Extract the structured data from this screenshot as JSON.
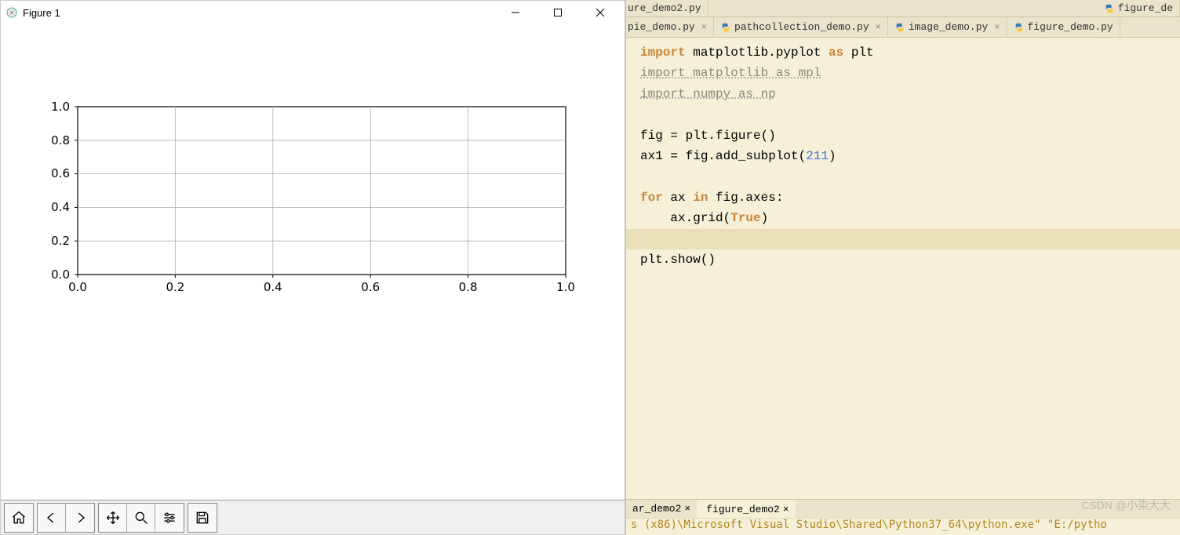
{
  "figure_window": {
    "title": "Figure 1",
    "toolbar": {
      "home": "Home",
      "back": "Back",
      "forward": "Forward",
      "pan": "Pan",
      "zoom": "Zoom",
      "configure": "Configure subplots",
      "save": "Save"
    }
  },
  "chart_data": {
    "type": "line",
    "title": "",
    "xlabel": "",
    "ylabel": "",
    "xlim": [
      0.0,
      1.0
    ],
    "ylim": [
      0.0,
      1.0
    ],
    "xticks": [
      0.0,
      0.2,
      0.4,
      0.6,
      0.8,
      1.0
    ],
    "yticks": [
      0.0,
      0.2,
      0.4,
      0.6,
      0.8,
      1.0
    ],
    "grid": true,
    "series": [],
    "subplot_position": 211,
    "xtick_labels": [
      "0.0",
      "0.2",
      "0.4",
      "0.6",
      "0.8",
      "1.0"
    ],
    "ytick_labels": [
      "0.0",
      "0.2",
      "0.4",
      "0.6",
      "0.8",
      "1.0"
    ]
  },
  "ide": {
    "top_partial_tab_left": "ure_demo2.py",
    "top_partial_tab_right": "figure_de",
    "tabs": [
      {
        "label": "pie_demo.py",
        "closable": true,
        "partial_left": true
      },
      {
        "label": "pathcollection_demo.py",
        "closable": true
      },
      {
        "label": "image_demo.py",
        "closable": true
      },
      {
        "label": "figure_demo.py",
        "closable": false,
        "partial_right": true
      }
    ],
    "code": {
      "l1_kw1": "import",
      "l1_rest": " matplotlib.pyplot ",
      "l1_kw2": "as",
      "l1_rest2": " plt",
      "l2": "import matplotlib as mpl",
      "l3": "import numpy as np",
      "l4": "",
      "l5_a": "fig = plt.figure()",
      "l6_a": "ax1 = fig.add_subplot(",
      "l6_num": "211",
      "l6_b": ")",
      "l7": "",
      "l8_kw": "for",
      "l8_a": " ax ",
      "l8_kw2": "in",
      "l8_b": " fig.axes:",
      "l9_a": "    ax.grid(",
      "l9_kw": "True",
      "l9_b": ")",
      "l10": "",
      "l11": "plt.show()"
    },
    "bottom_tabs": [
      {
        "label": "ar_demo2",
        "closable": true,
        "partial_left": true
      },
      {
        "label": "figure_demo2",
        "closable": true,
        "active": true
      }
    ],
    "console_left": "s (x86)\\Microsoft Visual Studio\\Shared\\Python37_64\\python.exe\" \"E:/pytho",
    "watermark": "CSDN @小染大大"
  }
}
